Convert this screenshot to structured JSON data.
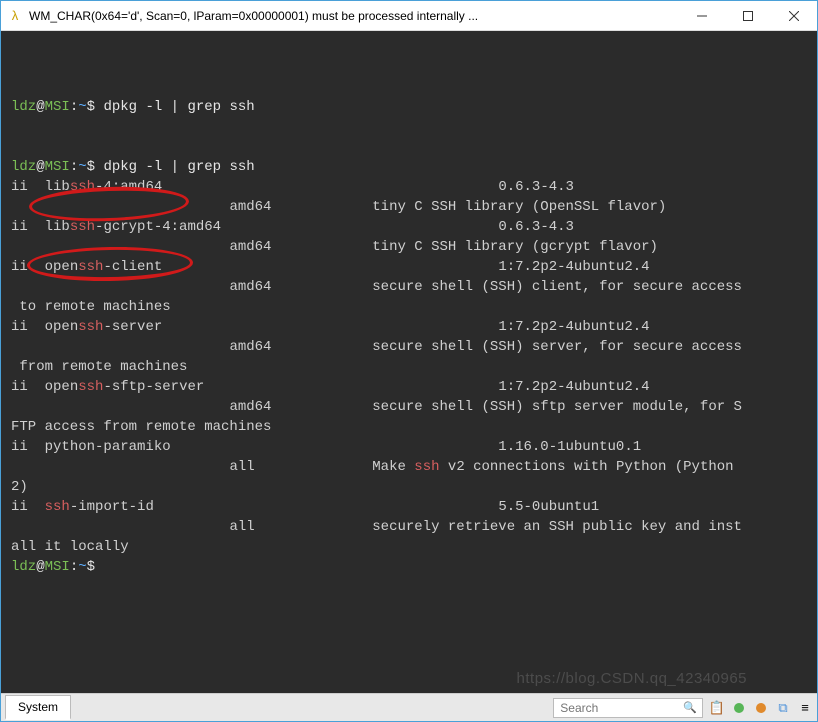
{
  "window": {
    "title": "WM_CHAR(0x64='d', Scan=0, lParam=0x00000001) must be processed internally ...",
    "icon_name": "lambda-icon"
  },
  "prompt": {
    "user": "ldz",
    "host": "MSI",
    "path": "~",
    "symbol": "$"
  },
  "command": {
    "cmd1": "dpkg -l | grep ssh"
  },
  "output": {
    "lines": [
      {
        "ii": "ii",
        "segments": [
          [
            "  lib",
            ""
          ],
          [
            "ssh",
            "red"
          ],
          [
            "-4:amd64",
            ""
          ]
        ],
        "right": "0.6.3-4.3"
      },
      {
        "arch": "amd64",
        "desc": "tiny C SSH library (OpenSSL flavor)"
      },
      {
        "ii": "ii",
        "segments": [
          [
            "  lib",
            ""
          ],
          [
            "ssh",
            "red"
          ],
          [
            "-gcrypt-4:amd64",
            ""
          ]
        ],
        "right": "0.6.3-4.3"
      },
      {
        "arch": "amd64",
        "desc": "tiny C SSH library (gcrypt flavor)"
      },
      {
        "ii": "ii",
        "segments": [
          [
            "  open",
            ""
          ],
          [
            "ssh",
            "red"
          ],
          [
            "-client",
            ""
          ]
        ],
        "right": "1:7.2p2-4ubuntu2.4"
      },
      {
        "arch": "amd64",
        "desc": "secure shell (SSH) client, for secure access"
      },
      {
        "cont": " to remote machines"
      },
      {
        "ii": "ii",
        "segments": [
          [
            "  open",
            ""
          ],
          [
            "ssh",
            "red"
          ],
          [
            "-server",
            ""
          ]
        ],
        "right": "1:7.2p2-4ubuntu2.4"
      },
      {
        "arch": "amd64",
        "desc": "secure shell (SSH) server, for secure access"
      },
      {
        "cont": " from remote machines"
      },
      {
        "ii": "ii",
        "segments": [
          [
            "  open",
            ""
          ],
          [
            "ssh",
            "red"
          ],
          [
            "-sftp-server",
            ""
          ]
        ],
        "right": "1:7.2p2-4ubuntu2.4"
      },
      {
        "arch": "amd64",
        "desc": "secure shell (SSH) sftp server module, for S"
      },
      {
        "cont": "FTP access from remote machines"
      },
      {
        "ii": "ii",
        "segments": [
          [
            "  python-paramiko",
            ""
          ]
        ],
        "right": "1.16.0-1ubuntu0.1"
      },
      {
        "arch": "all",
        "desc_segments": [
          [
            "Make ",
            ""
          ],
          [
            "ssh",
            "red"
          ],
          [
            " v2 connections with Python (Python ",
            ""
          ]
        ]
      },
      {
        "cont": "2)"
      },
      {
        "ii": "ii",
        "segments": [
          [
            "  ",
            ""
          ],
          [
            "ssh",
            "red"
          ],
          [
            "-import-id",
            ""
          ]
        ],
        "right": "5.5-0ubuntu1"
      },
      {
        "arch": "all",
        "desc": "securely retrieve an SSH public key and inst"
      },
      {
        "cont": "all it locally"
      }
    ]
  },
  "statusbar": {
    "tab": "System",
    "search_placeholder": "Search"
  },
  "watermark": "https://blog.CSDN.qq_42340965",
  "annotations": {
    "circled": [
      "openssh-client",
      "openssh-server"
    ]
  }
}
